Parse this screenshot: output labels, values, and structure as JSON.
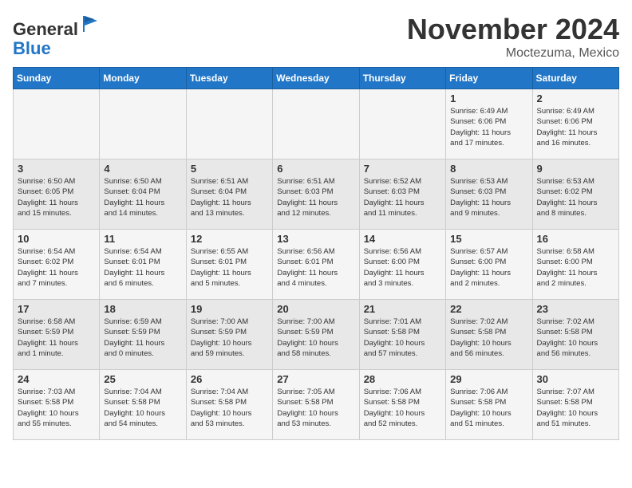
{
  "header": {
    "logo_line1": "General",
    "logo_line2": "Blue",
    "month": "November 2024",
    "location": "Moctezuma, Mexico"
  },
  "weekdays": [
    "Sunday",
    "Monday",
    "Tuesday",
    "Wednesday",
    "Thursday",
    "Friday",
    "Saturday"
  ],
  "weeks": [
    [
      {
        "day": "",
        "info": ""
      },
      {
        "day": "",
        "info": ""
      },
      {
        "day": "",
        "info": ""
      },
      {
        "day": "",
        "info": ""
      },
      {
        "day": "",
        "info": ""
      },
      {
        "day": "1",
        "info": "Sunrise: 6:49 AM\nSunset: 6:06 PM\nDaylight: 11 hours\nand 17 minutes."
      },
      {
        "day": "2",
        "info": "Sunrise: 6:49 AM\nSunset: 6:06 PM\nDaylight: 11 hours\nand 16 minutes."
      }
    ],
    [
      {
        "day": "3",
        "info": "Sunrise: 6:50 AM\nSunset: 6:05 PM\nDaylight: 11 hours\nand 15 minutes."
      },
      {
        "day": "4",
        "info": "Sunrise: 6:50 AM\nSunset: 6:04 PM\nDaylight: 11 hours\nand 14 minutes."
      },
      {
        "day": "5",
        "info": "Sunrise: 6:51 AM\nSunset: 6:04 PM\nDaylight: 11 hours\nand 13 minutes."
      },
      {
        "day": "6",
        "info": "Sunrise: 6:51 AM\nSunset: 6:03 PM\nDaylight: 11 hours\nand 12 minutes."
      },
      {
        "day": "7",
        "info": "Sunrise: 6:52 AM\nSunset: 6:03 PM\nDaylight: 11 hours\nand 11 minutes."
      },
      {
        "day": "8",
        "info": "Sunrise: 6:53 AM\nSunset: 6:03 PM\nDaylight: 11 hours\nand 9 minutes."
      },
      {
        "day": "9",
        "info": "Sunrise: 6:53 AM\nSunset: 6:02 PM\nDaylight: 11 hours\nand 8 minutes."
      }
    ],
    [
      {
        "day": "10",
        "info": "Sunrise: 6:54 AM\nSunset: 6:02 PM\nDaylight: 11 hours\nand 7 minutes."
      },
      {
        "day": "11",
        "info": "Sunrise: 6:54 AM\nSunset: 6:01 PM\nDaylight: 11 hours\nand 6 minutes."
      },
      {
        "day": "12",
        "info": "Sunrise: 6:55 AM\nSunset: 6:01 PM\nDaylight: 11 hours\nand 5 minutes."
      },
      {
        "day": "13",
        "info": "Sunrise: 6:56 AM\nSunset: 6:01 PM\nDaylight: 11 hours\nand 4 minutes."
      },
      {
        "day": "14",
        "info": "Sunrise: 6:56 AM\nSunset: 6:00 PM\nDaylight: 11 hours\nand 3 minutes."
      },
      {
        "day": "15",
        "info": "Sunrise: 6:57 AM\nSunset: 6:00 PM\nDaylight: 11 hours\nand 2 minutes."
      },
      {
        "day": "16",
        "info": "Sunrise: 6:58 AM\nSunset: 6:00 PM\nDaylight: 11 hours\nand 2 minutes."
      }
    ],
    [
      {
        "day": "17",
        "info": "Sunrise: 6:58 AM\nSunset: 5:59 PM\nDaylight: 11 hours\nand 1 minute."
      },
      {
        "day": "18",
        "info": "Sunrise: 6:59 AM\nSunset: 5:59 PM\nDaylight: 11 hours\nand 0 minutes."
      },
      {
        "day": "19",
        "info": "Sunrise: 7:00 AM\nSunset: 5:59 PM\nDaylight: 10 hours\nand 59 minutes."
      },
      {
        "day": "20",
        "info": "Sunrise: 7:00 AM\nSunset: 5:59 PM\nDaylight: 10 hours\nand 58 minutes."
      },
      {
        "day": "21",
        "info": "Sunrise: 7:01 AM\nSunset: 5:58 PM\nDaylight: 10 hours\nand 57 minutes."
      },
      {
        "day": "22",
        "info": "Sunrise: 7:02 AM\nSunset: 5:58 PM\nDaylight: 10 hours\nand 56 minutes."
      },
      {
        "day": "23",
        "info": "Sunrise: 7:02 AM\nSunset: 5:58 PM\nDaylight: 10 hours\nand 56 minutes."
      }
    ],
    [
      {
        "day": "24",
        "info": "Sunrise: 7:03 AM\nSunset: 5:58 PM\nDaylight: 10 hours\nand 55 minutes."
      },
      {
        "day": "25",
        "info": "Sunrise: 7:04 AM\nSunset: 5:58 PM\nDaylight: 10 hours\nand 54 minutes."
      },
      {
        "day": "26",
        "info": "Sunrise: 7:04 AM\nSunset: 5:58 PM\nDaylight: 10 hours\nand 53 minutes."
      },
      {
        "day": "27",
        "info": "Sunrise: 7:05 AM\nSunset: 5:58 PM\nDaylight: 10 hours\nand 53 minutes."
      },
      {
        "day": "28",
        "info": "Sunrise: 7:06 AM\nSunset: 5:58 PM\nDaylight: 10 hours\nand 52 minutes."
      },
      {
        "day": "29",
        "info": "Sunrise: 7:06 AM\nSunset: 5:58 PM\nDaylight: 10 hours\nand 51 minutes."
      },
      {
        "day": "30",
        "info": "Sunrise: 7:07 AM\nSunset: 5:58 PM\nDaylight: 10 hours\nand 51 minutes."
      }
    ]
  ]
}
